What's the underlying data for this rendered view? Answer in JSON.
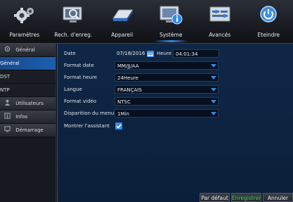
{
  "topnav": {
    "items": [
      {
        "label": "Paramètres",
        "icon": "gears-icon"
      },
      {
        "label": "Rech. d'enreg.",
        "icon": "search-monitor-icon"
      },
      {
        "label": "Appareil",
        "icon": "hard-drive-icon"
      },
      {
        "label": "Système",
        "icon": "system-info-icon",
        "active": true
      },
      {
        "label": "Avancés",
        "icon": "advanced-settings-icon"
      },
      {
        "label": "Eteindre",
        "icon": "power-icon"
      }
    ]
  },
  "sidebar": {
    "general_section": "Général",
    "general_items": [
      "Général",
      "DST",
      "NTP"
    ],
    "active_item": "Général",
    "users_section": "Utilisateurs",
    "info_section": "Infos",
    "startup_section": "Démarrage"
  },
  "form": {
    "date_label": "Date",
    "date_value": "07/18/2016",
    "time_label": "Heure",
    "time_value": "04:01:34",
    "date_format_label": "Format date",
    "date_format_value": "MM/JJ/AA",
    "time_format_label": "Format heure",
    "time_format_value": "24Heure",
    "language_label": "Langue",
    "language_value": "FRANÇAIS",
    "video_format_label": "Format vidéo",
    "video_format_value": "NTSC",
    "menu_timeout_label": "Disparition du menu",
    "menu_timeout_value": "1Min",
    "show_wizard_label": "Montrer l'assistant",
    "show_wizard_checked": true
  },
  "buttons": {
    "default_label": "Par défaut",
    "save_label": "Enregistrer",
    "cancel_label": "Annuler"
  },
  "colors": {
    "accent": "#2d8bf0",
    "save_text": "#3fd04a",
    "active_tab": "#1b5fb0"
  }
}
